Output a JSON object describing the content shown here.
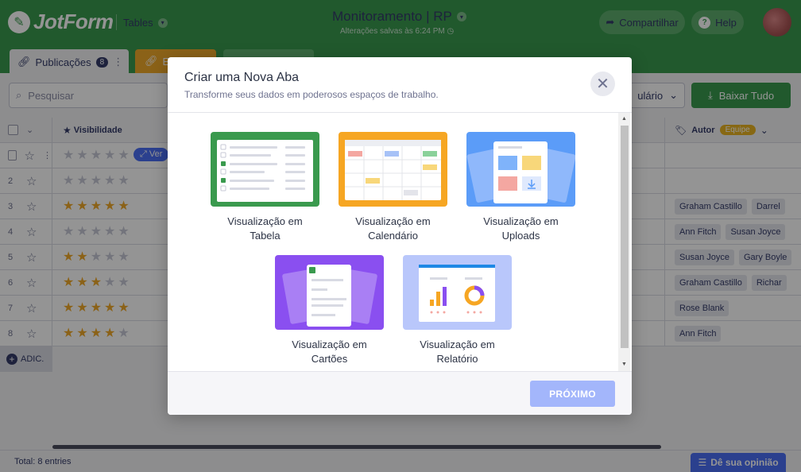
{
  "header": {
    "logo_text": "JotForm",
    "app_switcher": "Tables",
    "title": "Monitoramento | RP",
    "saved_status": "Alterações salvas às 6:24 PM",
    "share_label": "Compartilhar",
    "help_label": "Help",
    "brand_color": "#3a9a4e"
  },
  "tabs": [
    {
      "label": "Publicações",
      "count": "8"
    },
    {
      "label": "E"
    }
  ],
  "toolbar": {
    "search_placeholder": "Pesquisar",
    "form_select_label": "ulário",
    "download_label": "Baixar Tudo"
  },
  "table": {
    "visibility_header": "Visibilidade",
    "author_header": "Autor",
    "team_badge": "Equipe",
    "view_button": "Ver",
    "add_label": "ADIC.",
    "rows": [
      {
        "num": "",
        "stars": 0,
        "authors": []
      },
      {
        "num": "2",
        "stars": 0,
        "authors": []
      },
      {
        "num": "3",
        "stars": 5,
        "authors": [
          "Graham Castillo",
          "Darrel"
        ]
      },
      {
        "num": "4",
        "stars": 0,
        "authors": [
          "Ann Fitch",
          "Susan Joyce"
        ]
      },
      {
        "num": "5",
        "stars": 2,
        "authors": [
          "Susan Joyce",
          "Gary Boyle"
        ]
      },
      {
        "num": "6",
        "stars": 3,
        "authors": [
          "Graham Castillo",
          "Richar"
        ]
      },
      {
        "num": "7",
        "stars": 5,
        "authors": [
          "Rose Blank"
        ]
      },
      {
        "num": "8",
        "stars": 4,
        "authors": [
          "Ann Fitch"
        ]
      }
    ]
  },
  "footer": {
    "total": "Total: 8 entries",
    "feedback_label": "Dê sua opinião"
  },
  "modal": {
    "title": "Criar uma Nova Aba",
    "subtitle": "Transforme seus dados em poderosos espaços de trabalho.",
    "next_label": "PRÓXIMO",
    "options": [
      {
        "line1": "Visualização em",
        "line2": "Tabela",
        "color": "#3a9a4e"
      },
      {
        "line1": "Visualização em",
        "line2": "Calendário",
        "color": "#f6a623"
      },
      {
        "line1": "Visualização em",
        "line2": "Uploads",
        "color": "#5b9cf8"
      },
      {
        "line1": "Visualização em",
        "line2": "Cartões",
        "color": "#8a4ff0"
      },
      {
        "line1": "Visualização em",
        "line2": "Relatório",
        "color": "#b9c7fb"
      }
    ]
  }
}
